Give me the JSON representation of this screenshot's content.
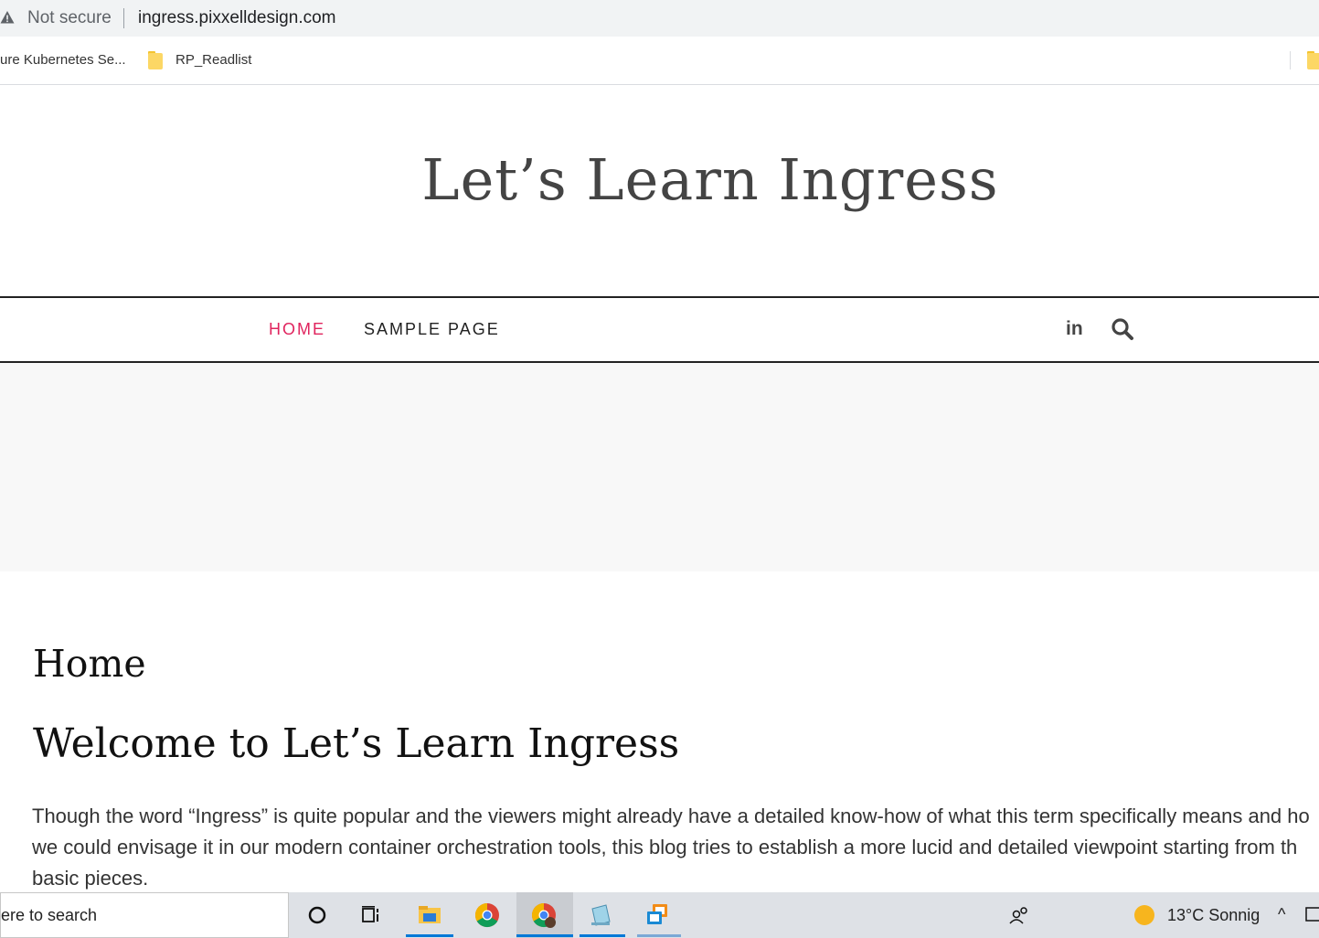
{
  "browser": {
    "security_label": "Not secure",
    "url": "ingress.pixxelldesign.com"
  },
  "bookmarks": {
    "items": [
      {
        "label": "ure Kubernetes Se..."
      },
      {
        "label": "RP_Readlist"
      }
    ]
  },
  "site": {
    "title": "Let’s Learn Ingress"
  },
  "nav": {
    "items": [
      {
        "label": "HOME",
        "active": true
      },
      {
        "label": "SAMPLE PAGE",
        "active": false
      }
    ],
    "social_icon": "linkedin-icon",
    "linkedin_text": "in",
    "search_icon": "search-icon"
  },
  "content": {
    "page_heading": "Home",
    "welcome_heading": "Welcome to Let’s Learn Ingress",
    "paragraph_line_1": "Though the word “Ingress” is quite popular and the viewers might already have a detailed know-how of what this term specifically means and ho",
    "paragraph_line_2": "we could envisage it in our modern container orchestration tools, this blog tries to establish a more lucid and detailed viewpoint starting from th",
    "paragraph_line_3": "basic pieces."
  },
  "taskbar": {
    "search_text": "ere to search",
    "weather": "13°C  Sonnig",
    "apps": [
      "cortana-icon",
      "task-view-icon",
      "file-explorer-icon",
      "chrome-icon",
      "chrome-profile-icon",
      "notepad-icon",
      "remote-desktop-icon"
    ]
  },
  "colors": {
    "accent": "#e0245e",
    "nav_border": "#222222"
  }
}
